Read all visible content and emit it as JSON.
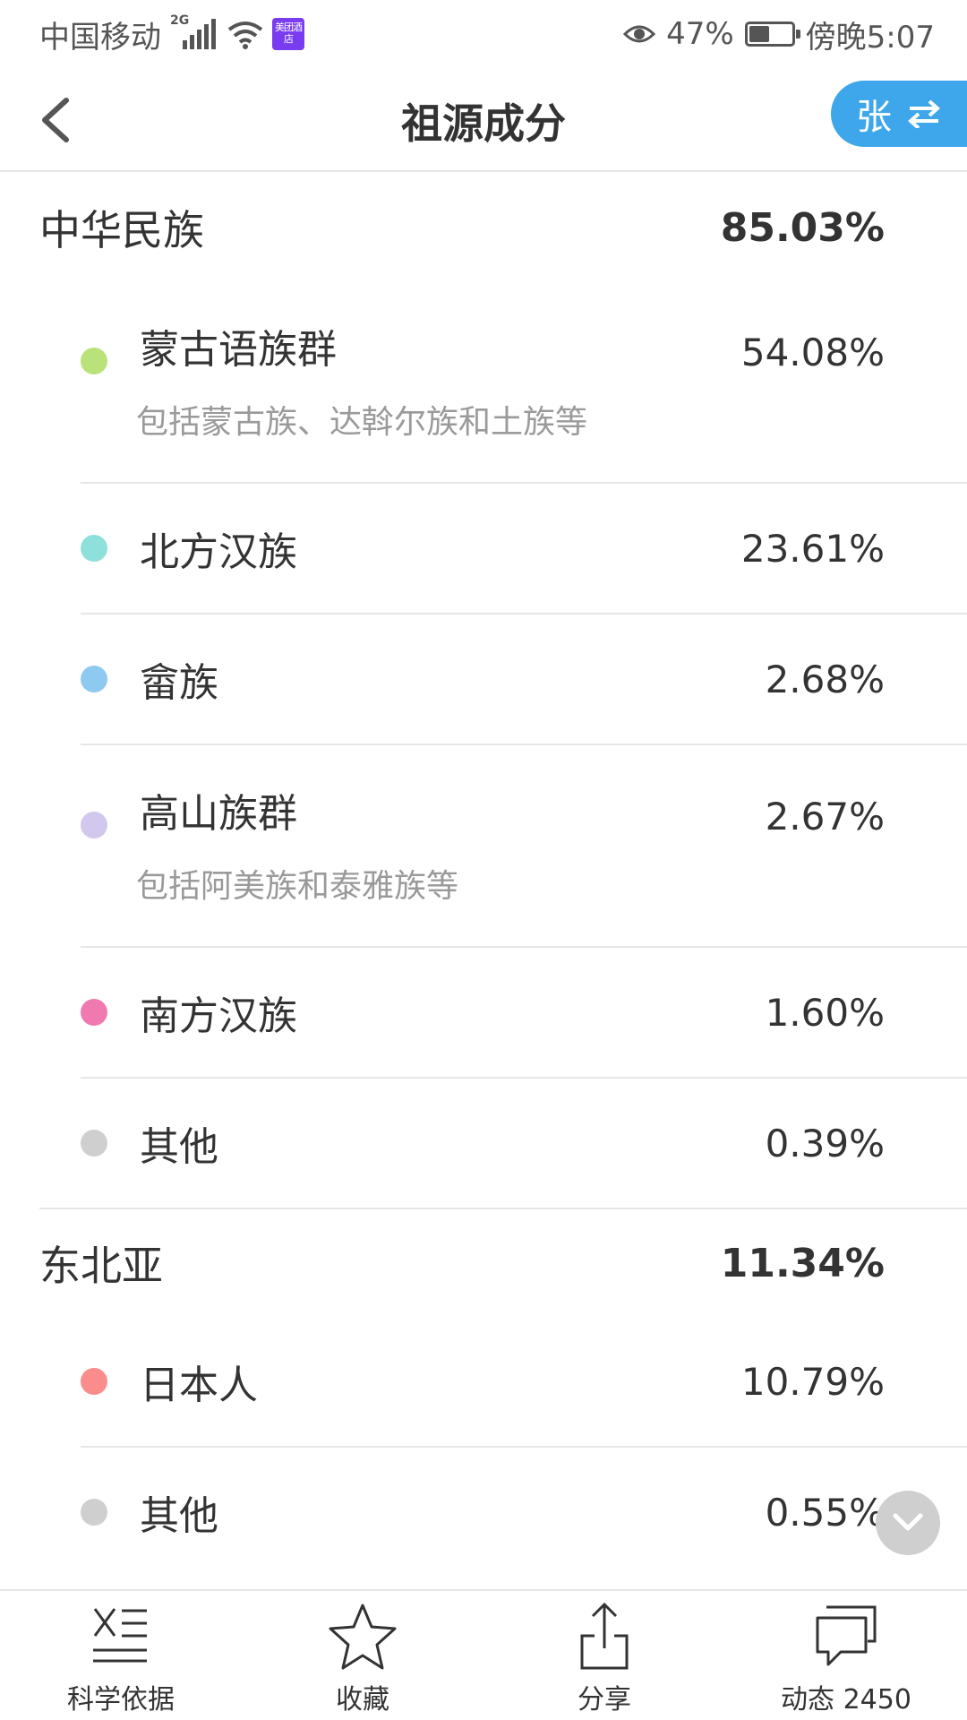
{
  "status_bar": {
    "carrier": "中国移动",
    "network": "2G",
    "hotel_badge": "美团酒店",
    "battery": "47%",
    "battery_level": 0.47,
    "time": "傍晚5:07"
  },
  "header": {
    "title": "祖源成分",
    "switch_label": "张"
  },
  "groups": [
    {
      "name": "中华民族",
      "percent": "85.03%",
      "items": [
        {
          "name": "蒙古语族群",
          "percent": "54.08%",
          "desc": "包括蒙古族、达斡尔族和土族等",
          "color": "#b9e27a"
        },
        {
          "name": "北方汉族",
          "percent": "23.61%",
          "color": "#8ee0dc"
        },
        {
          "name": "畲族",
          "percent": "2.68%",
          "color": "#8ec9f0"
        },
        {
          "name": "高山族群",
          "percent": "2.67%",
          "desc": "包括阿美族和泰雅族等",
          "color": "#d2c8ee"
        },
        {
          "name": "南方汉族",
          "percent": "1.60%",
          "color": "#f07ab0"
        },
        {
          "name": "其他",
          "percent": "0.39%",
          "color": "#cfcfcf"
        }
      ]
    },
    {
      "name": "东北亚",
      "percent": "11.34%",
      "items": [
        {
          "name": "日本人",
          "percent": "10.79%",
          "color": "#fb8c8c"
        },
        {
          "name": "其他",
          "percent": "0.55%",
          "color": "#cfcfcf"
        }
      ]
    }
  ],
  "bottom_tabs": [
    {
      "label": "科学依据",
      "icon": "science-basis-icon"
    },
    {
      "label": "收藏",
      "icon": "star-icon"
    },
    {
      "label": "分享",
      "icon": "share-icon"
    },
    {
      "label": "动态 2450",
      "icon": "comment-icon"
    }
  ],
  "colors": {
    "accent": "#3ea6ea",
    "divider": "#e6e6e6"
  }
}
